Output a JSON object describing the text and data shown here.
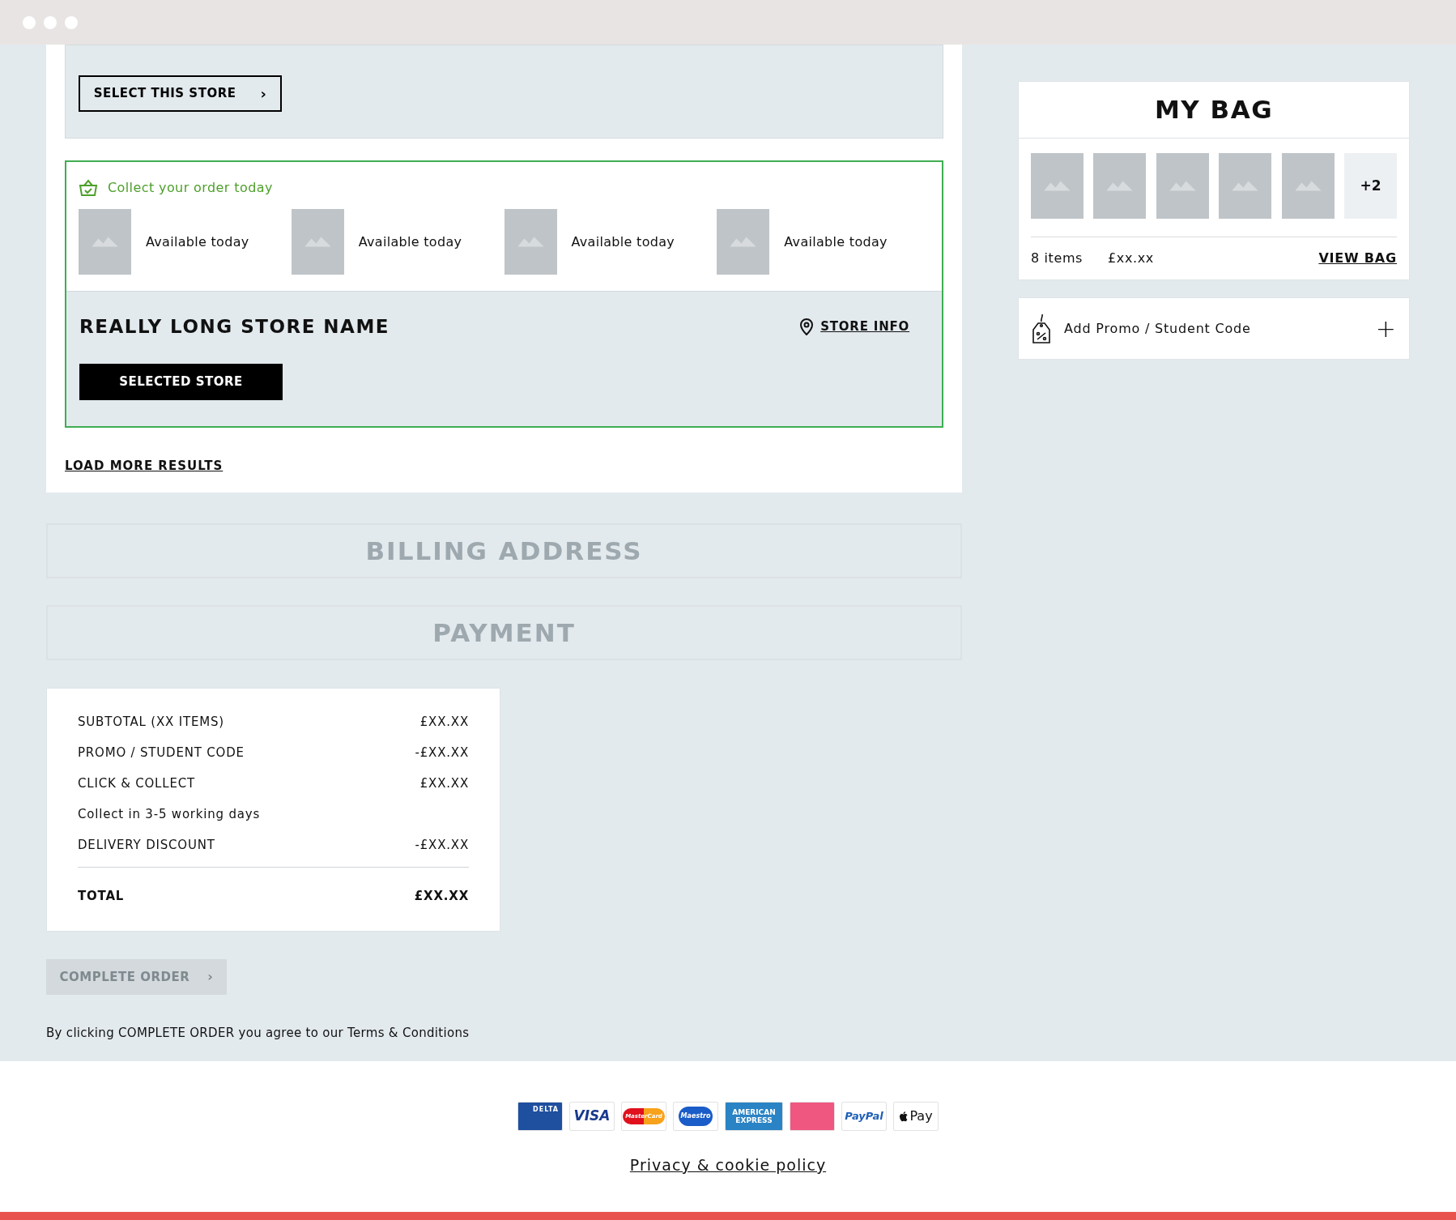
{
  "stores": [
    {
      "selected": false,
      "button": "SELECT THIS STORE",
      "button_icon": "›"
    },
    {
      "selected": true,
      "collect_title": "Collect your order today",
      "items": [
        {
          "availability": "Available today"
        },
        {
          "availability": "Available today"
        },
        {
          "availability": "Available today"
        },
        {
          "availability": "Available today"
        }
      ],
      "name": "REALLY LONG STORE NAME",
      "store_info": "STORE INFO",
      "button": "SELECTED STORE"
    }
  ],
  "load_more": "LOAD MORE RESULTS",
  "sections": [
    {
      "title": "BILLING ADDRESS",
      "disabled": true
    },
    {
      "title": "PAYMENT",
      "disabled": true
    }
  ],
  "summary": [
    {
      "kind": "line",
      "label": "SUBTOTAL (XX ITEMS)",
      "value": "£XX.XX"
    },
    {
      "kind": "line",
      "label": "PROMO / STUDENT CODE",
      "value": "-£XX.XX"
    },
    {
      "kind": "line",
      "label": "CLICK & COLLECT",
      "value": "£XX.XX"
    },
    {
      "kind": "note",
      "label": "Collect in 3-5 working days"
    },
    {
      "kind": "line",
      "label": "DELIVERY DISCOUNT",
      "value": "-£XX.XX"
    },
    {
      "kind": "total",
      "label": "TOTAL",
      "value": "£XX.XX"
    }
  ],
  "complete_button": {
    "label": "COMPLETE ORDER",
    "icon": "›",
    "disabled": true
  },
  "terms": "By clicking COMPLETE ORDER you agree to our Terms & Conditions",
  "bag": {
    "title": "MY BAG",
    "thumbnails": [
      {
        "kind": "image"
      },
      {
        "kind": "image"
      },
      {
        "kind": "image"
      },
      {
        "kind": "image"
      },
      {
        "kind": "image"
      }
    ],
    "more": "+2",
    "count": "8 items",
    "total": "£xx.xx",
    "view": "VIEW BAG"
  },
  "promo": {
    "label": "Add Promo / Student Code",
    "icon": "+"
  },
  "payment_logos": [
    {
      "kind": "delta",
      "text": "DELTA"
    },
    {
      "kind": "visa",
      "text": "VISA"
    },
    {
      "kind": "mastercard",
      "text": "MasterCard"
    },
    {
      "kind": "maestro",
      "text": "Maestro"
    },
    {
      "kind": "amex",
      "text": "AMERICAN EXPRESS"
    },
    {
      "kind": "storecard"
    },
    {
      "kind": "paypal",
      "text": "PayPal"
    },
    {
      "kind": "applepay",
      "text": "Pay"
    }
  ],
  "privacy": "Privacy & cookie policy"
}
